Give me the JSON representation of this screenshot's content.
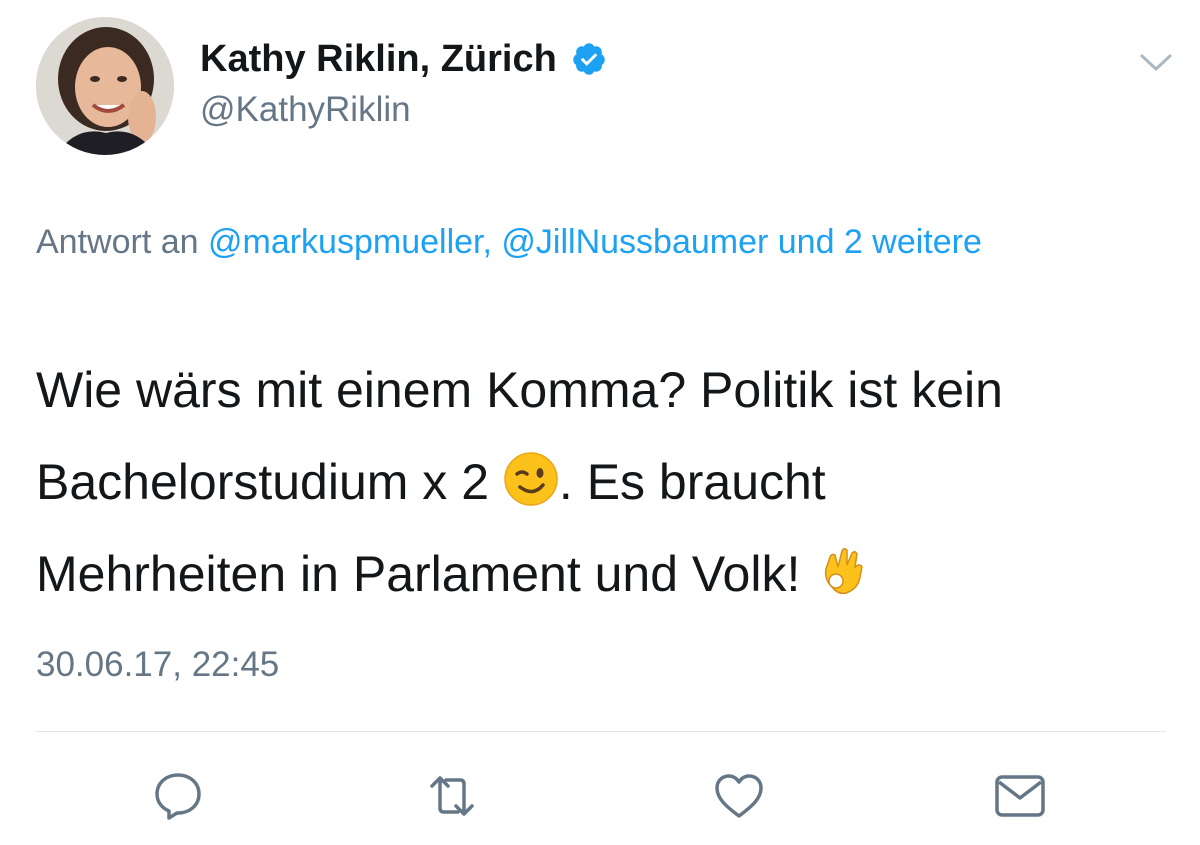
{
  "tweet": {
    "display_name": "Kathy Riklin, Zürich",
    "handle": "@KathyRiklin",
    "verified_icon": "verified-badge-icon",
    "menu_icon": "chevron-down-icon",
    "reply": {
      "prefix": "Antwort an ",
      "mention_1": "@markuspmueller",
      "separator": ", ",
      "mention_2": "@JillNussbaumer",
      "others": " und 2 weitere"
    },
    "text": {
      "line1": "Wie wärs mit einem Komma? Politik ist kein",
      "line2a": "Bachelorstudium x 2 ",
      "emoji_1": "winking-face-emoji",
      "line2b": ". Es braucht",
      "line3": "Mehrheiten in Parlament und Volk! ",
      "emoji_2": "ok-hand-emoji"
    },
    "timestamp": "30.06.17, 22:45"
  },
  "actions": [
    {
      "name": "reply",
      "icon": "reply-icon"
    },
    {
      "name": "retweet",
      "icon": "retweet-icon"
    },
    {
      "name": "like",
      "icon": "heart-icon"
    },
    {
      "name": "direct-message",
      "icon": "envelope-icon"
    }
  ],
  "colors": {
    "text": "#14171a",
    "secondary": "#657786",
    "link": "#1da1f2",
    "divider": "#e1e8ed"
  }
}
